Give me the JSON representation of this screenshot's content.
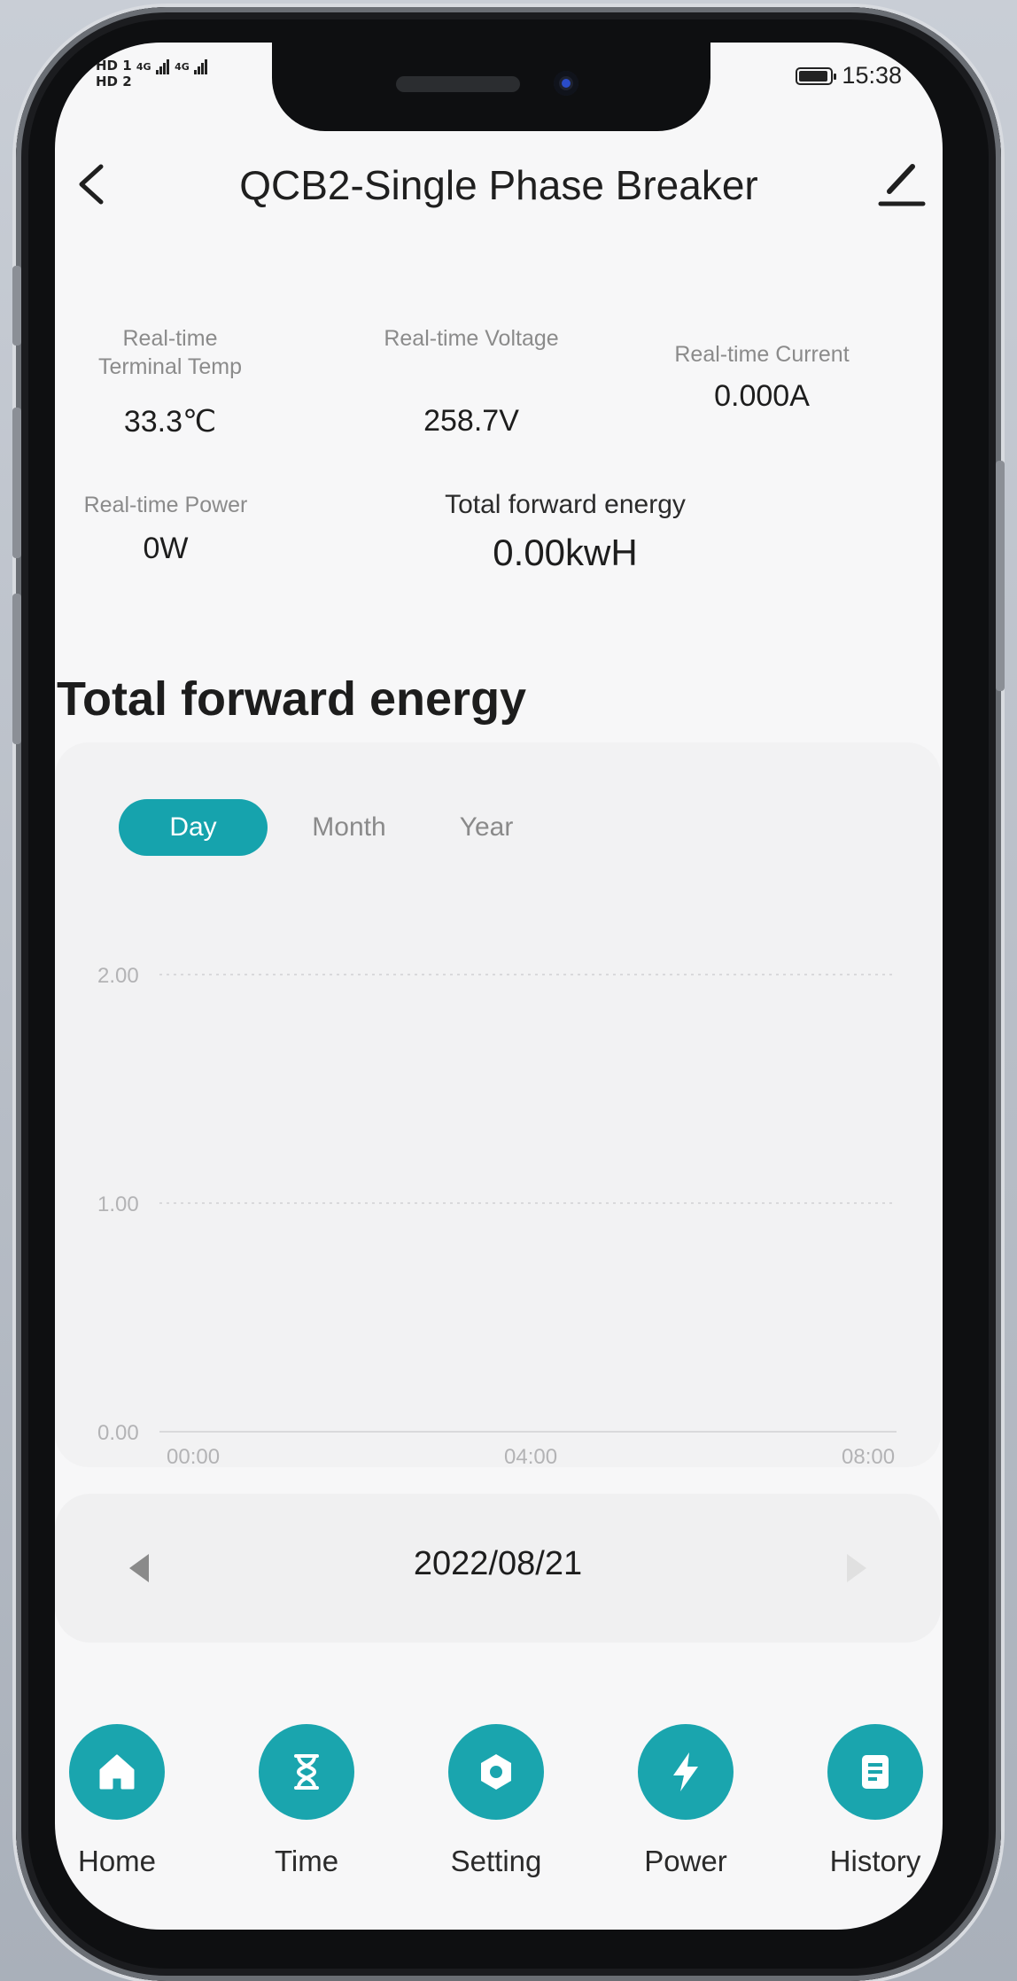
{
  "status_bar": {
    "left_badges": [
      "HD 1",
      "HD 2"
    ],
    "network": [
      "4G",
      "4G"
    ],
    "time": "15:38"
  },
  "header": {
    "title": "QCB2-Single Phase Breaker"
  },
  "metrics": {
    "terminal_temp": {
      "label_line1": "Real-time",
      "label_line2": "Terminal Temp",
      "value": "33.3℃"
    },
    "voltage": {
      "label": "Real-time Voltage",
      "value": "258.7V"
    },
    "current": {
      "label": "Real-time Current",
      "value": "0.000A"
    },
    "power": {
      "label": "Real-time Power",
      "value": "0W"
    },
    "energy": {
      "label": "Total forward energy",
      "value": "0.00kwH"
    }
  },
  "section_title": "Total forward energy",
  "tabs": [
    {
      "label": "Day",
      "active": true
    },
    {
      "label": "Month",
      "active": false
    },
    {
      "label": "Year",
      "active": false
    }
  ],
  "chart_data": {
    "type": "line",
    "y_ticks": [
      "2.00",
      "1.00",
      "0.00"
    ],
    "x_ticks": [
      "00:00",
      "04:00",
      "08:00"
    ],
    "ylim": [
      0,
      2
    ],
    "grid": true,
    "series": [],
    "accent_color": "#16a3ad"
  },
  "date_nav": {
    "date": "2022/08/21"
  },
  "bottom_nav": [
    {
      "label": "Home",
      "icon": "home-icon"
    },
    {
      "label": "Time",
      "icon": "hourglass-icon"
    },
    {
      "label": "Setting",
      "icon": "hex-nut-icon"
    },
    {
      "label": "Power",
      "icon": "lightning-icon"
    },
    {
      "label": "History",
      "icon": "document-icon"
    }
  ],
  "colors": {
    "accent": "#16a3ad",
    "nav_circle": "#1aa5ae"
  }
}
